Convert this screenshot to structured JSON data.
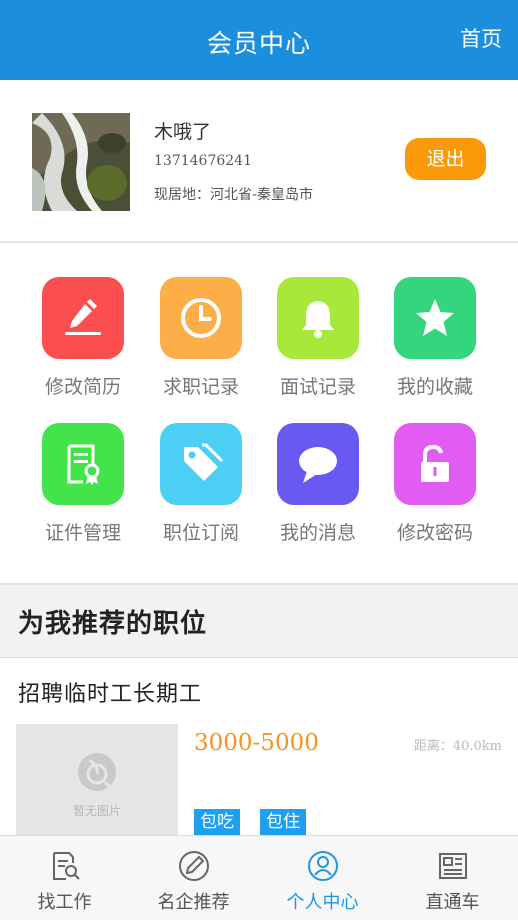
{
  "header": {
    "title": "会员中心",
    "home_label": "首页"
  },
  "profile": {
    "name": "木哦了",
    "phone": "13714676241",
    "location": "现居地：河北省-秦皇岛市",
    "logout_label": "退出"
  },
  "menu": [
    {
      "label": "修改简历",
      "icon": "edit-resume-icon",
      "color": "#fb4f4f"
    },
    {
      "label": "求职记录",
      "icon": "clock-icon",
      "color": "#fdae49"
    },
    {
      "label": "面试记录",
      "icon": "bell-icon",
      "color": "#a8e83a"
    },
    {
      "label": "我的收藏",
      "icon": "star-icon",
      "color": "#33d67c"
    },
    {
      "label": "证件管理",
      "icon": "certificate-icon",
      "color": "#43e34b"
    },
    {
      "label": "职位订阅",
      "icon": "tag-icon",
      "color": "#4bcff5"
    },
    {
      "label": "我的消息",
      "icon": "chat-bubble-icon",
      "color": "#6a59f0"
    },
    {
      "label": "修改密码",
      "icon": "unlock-icon",
      "color": "#e25cf3"
    }
  ],
  "recommend": {
    "heading": "为我推荐的职位",
    "job": {
      "title": "招聘临时工长期工",
      "salary": "3000-5000",
      "distance": "距离：40.0km",
      "no_image": "暂无图片",
      "tags": [
        "包吃",
        "包住"
      ]
    }
  },
  "tabs": [
    {
      "label": "找工作",
      "icon": "job-search-icon"
    },
    {
      "label": "名企推荐",
      "icon": "pen-icon"
    },
    {
      "label": "个人中心",
      "icon": "user-icon",
      "active": true
    },
    {
      "label": "直通车",
      "icon": "news-icon"
    }
  ],
  "colors": {
    "primary": "#1b8fde",
    "accent_orange": "#fa9a0a",
    "tag_blue": "#1f9ff0",
    "tab_active": "#1f96e4"
  }
}
